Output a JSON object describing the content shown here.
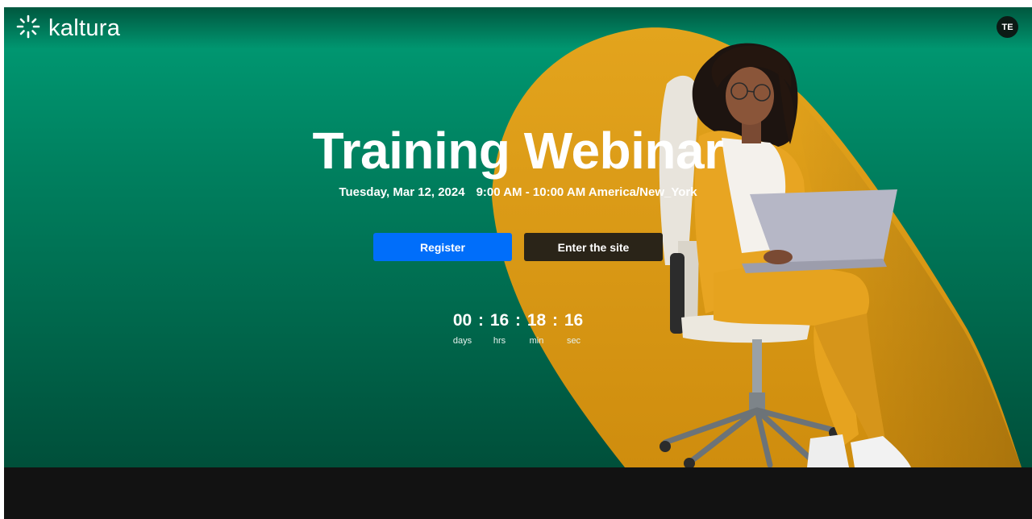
{
  "brand": {
    "logo_text": "kaltura",
    "logo_icon": "kaltura-burst-icon"
  },
  "user": {
    "initials": "TE"
  },
  "event": {
    "title": "Training Webinar",
    "date": "Tuesday, Mar 12, 2024",
    "time": "9:00 AM - 10:00 AM America/New_York"
  },
  "actions": {
    "register_label": "Register",
    "enter_label": "Enter the site"
  },
  "countdown": {
    "days": "00",
    "hours": "16",
    "minutes": "18",
    "seconds": "16",
    "separator": ":",
    "days_label": "days",
    "hours_label": "hrs",
    "minutes_label": "min",
    "seconds_label": "sec"
  },
  "colors": {
    "hero_green": "#00805f",
    "accent_yellow": "#e0a21a",
    "register_blue": "#006efa",
    "enter_button": "#2a2418",
    "footer_dark": "#121212"
  }
}
